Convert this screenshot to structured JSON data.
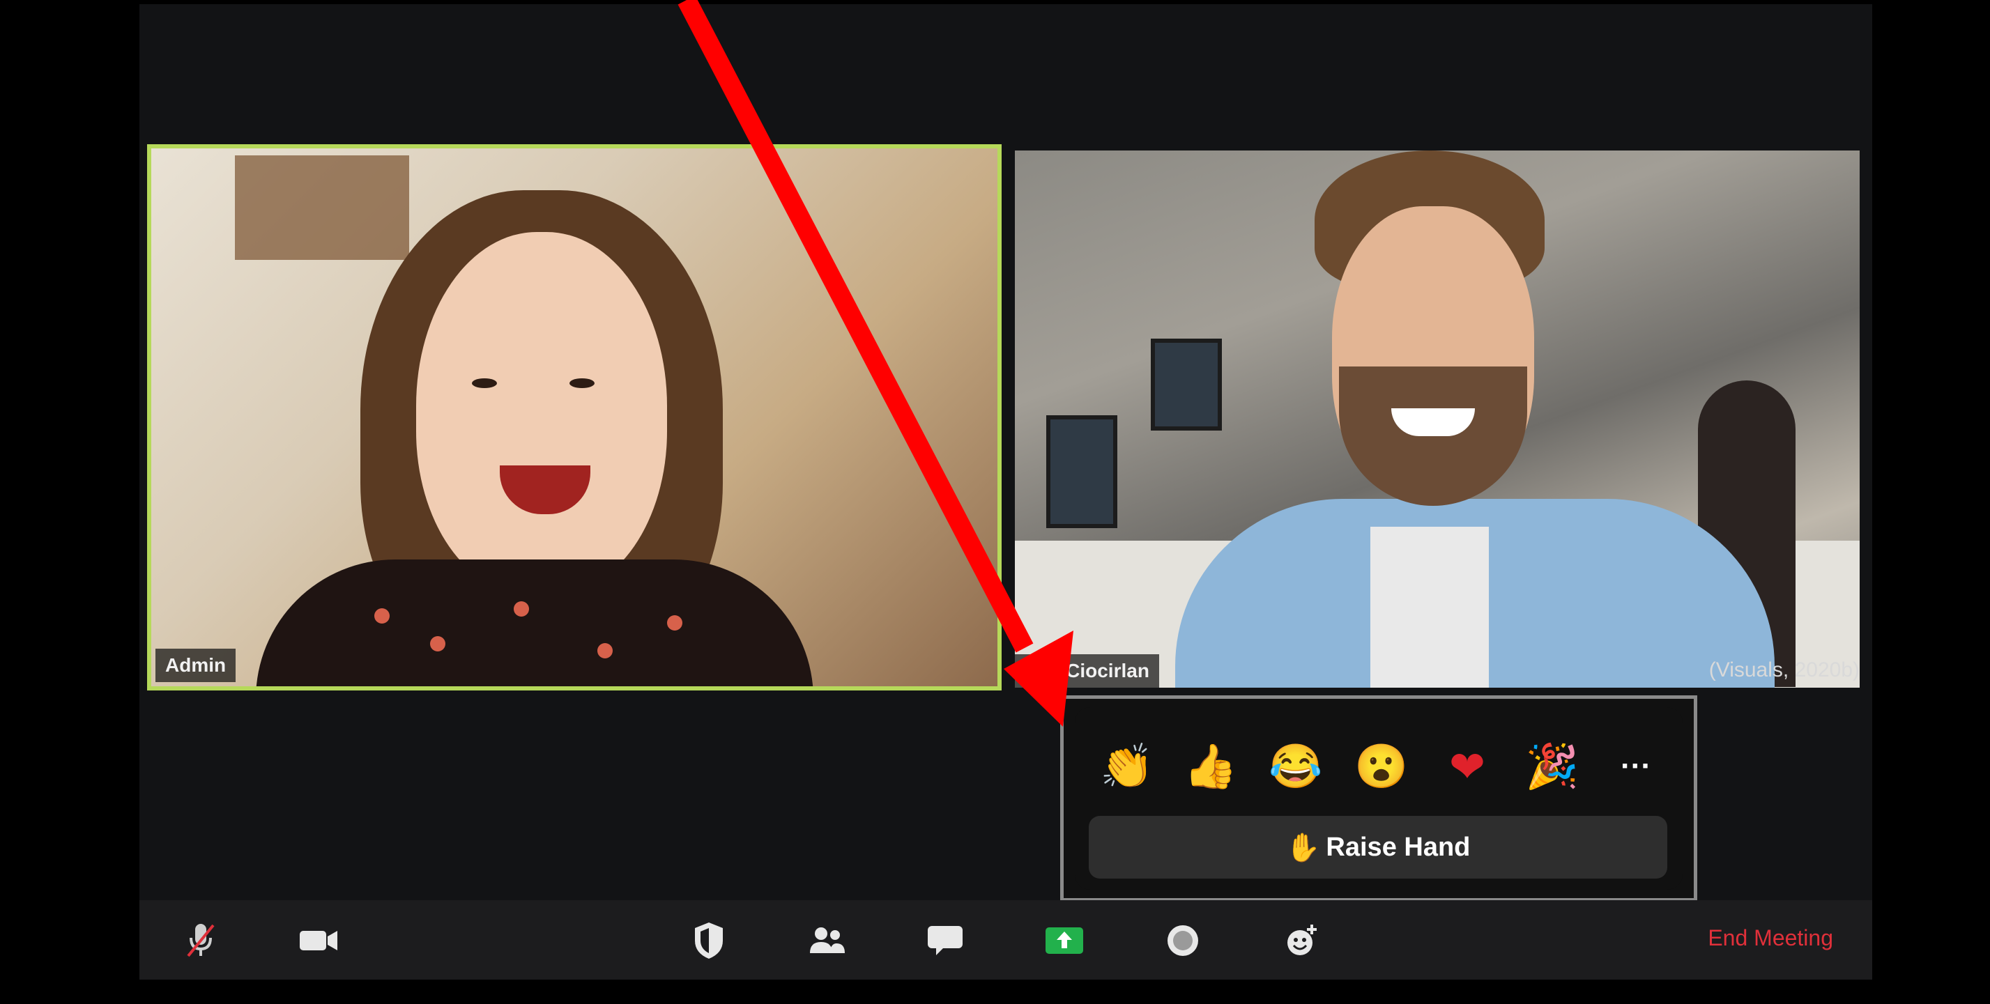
{
  "participants": {
    "admin": {
      "name": "Admin"
    },
    "other": {
      "name": "rius Ciocirlan"
    }
  },
  "credit": "(Visuals, 2020b)",
  "reactions": {
    "items": [
      {
        "icon": "clapping-hands-icon",
        "glyph": "👏"
      },
      {
        "icon": "thumbs-up-icon",
        "glyph": "👍"
      },
      {
        "icon": "tears-of-joy-icon",
        "glyph": "😂"
      },
      {
        "icon": "surprised-face-icon",
        "glyph": "😮"
      },
      {
        "icon": "heart-icon",
        "glyph": "❤"
      },
      {
        "icon": "party-popper-icon",
        "glyph": "🎉"
      },
      {
        "icon": "more-icon",
        "glyph": "···"
      }
    ],
    "raise_hand_glyph": "✋",
    "raise_hand_label": "Raise Hand"
  },
  "toolbar": {
    "items": [
      {
        "icon": "microphone-muted-icon"
      },
      {
        "icon": "video-camera-icon"
      },
      {
        "icon": "security-shield-icon"
      },
      {
        "icon": "participants-icon"
      },
      {
        "icon": "chat-icon"
      },
      {
        "icon": "share-screen-icon"
      },
      {
        "icon": "record-icon"
      },
      {
        "icon": "reactions-icon"
      }
    ],
    "end_label": "End Meeting"
  },
  "colors": {
    "active_speaker_border": "#b6d95a",
    "share_green": "#22b14c",
    "end_red": "#e0303a",
    "annotation_arrow": "#ff0000"
  }
}
